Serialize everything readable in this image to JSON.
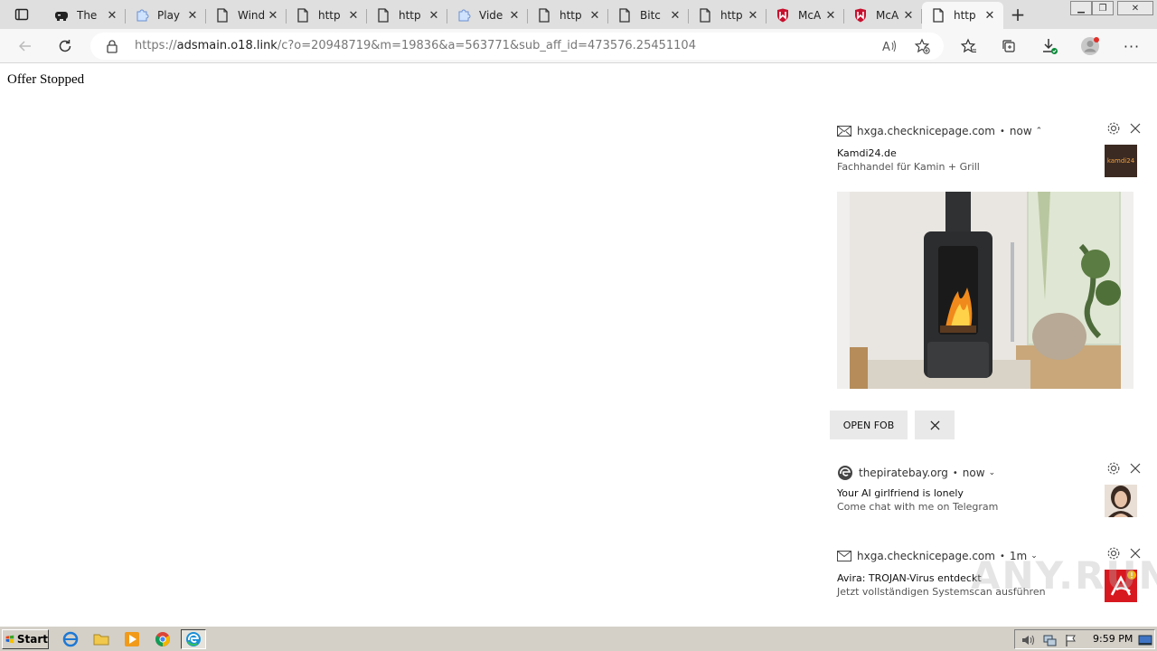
{
  "browser": {
    "tabs": [
      {
        "title": "The",
        "icon": "gamepad-icon",
        "active": false
      },
      {
        "title": "Play",
        "icon": "puzzle-icon",
        "active": false
      },
      {
        "title": "Wind",
        "icon": "page-icon",
        "active": false
      },
      {
        "title": "http",
        "icon": "page-icon",
        "active": false
      },
      {
        "title": "http",
        "icon": "page-icon",
        "active": false
      },
      {
        "title": "Vide",
        "icon": "puzzle-icon",
        "active": false
      },
      {
        "title": "http",
        "icon": "page-icon",
        "active": false
      },
      {
        "title": "Bitc",
        "icon": "page-icon",
        "active": false
      },
      {
        "title": "http",
        "icon": "page-icon",
        "active": false
      },
      {
        "title": "McA",
        "icon": "mcafee-shield-icon",
        "active": false
      },
      {
        "title": "McA",
        "icon": "mcafee-shield-icon",
        "active": false
      },
      {
        "title": "http",
        "icon": "page-icon",
        "active": true
      }
    ],
    "address": {
      "scheme": "https://",
      "host": "adsmain.o18.link",
      "path": "/c?o=20948719&m=19836&a=563771&sub_aff_id=473576.25451104"
    },
    "accent": "#0c8a3a"
  },
  "page": {
    "text": "Offer Stopped"
  },
  "notifications": [
    {
      "source": "hxga.checknicepage.com",
      "time": "now",
      "title": "Kamdi24.de",
      "body": "Fachhandel für Kamin + Grill",
      "thumb_label": "kamdi24",
      "action_label": "OPEN FOB",
      "expanded": true
    },
    {
      "source": "thepiratebay.org",
      "time": "now",
      "title": "Your AI girlfriend is lonely",
      "body": "Come chat with me on Telegram",
      "expanded": false
    },
    {
      "source": "hxga.checknicepage.com",
      "time": "1m",
      "title": "Avira: TROJAN-Virus entdeckt",
      "body": "Jetzt vollständigen Systemscan ausführen",
      "expanded": false
    }
  ],
  "watermark": "ANY.RUN",
  "taskbar": {
    "start_label": "Start",
    "clock": "9:59 PM"
  }
}
